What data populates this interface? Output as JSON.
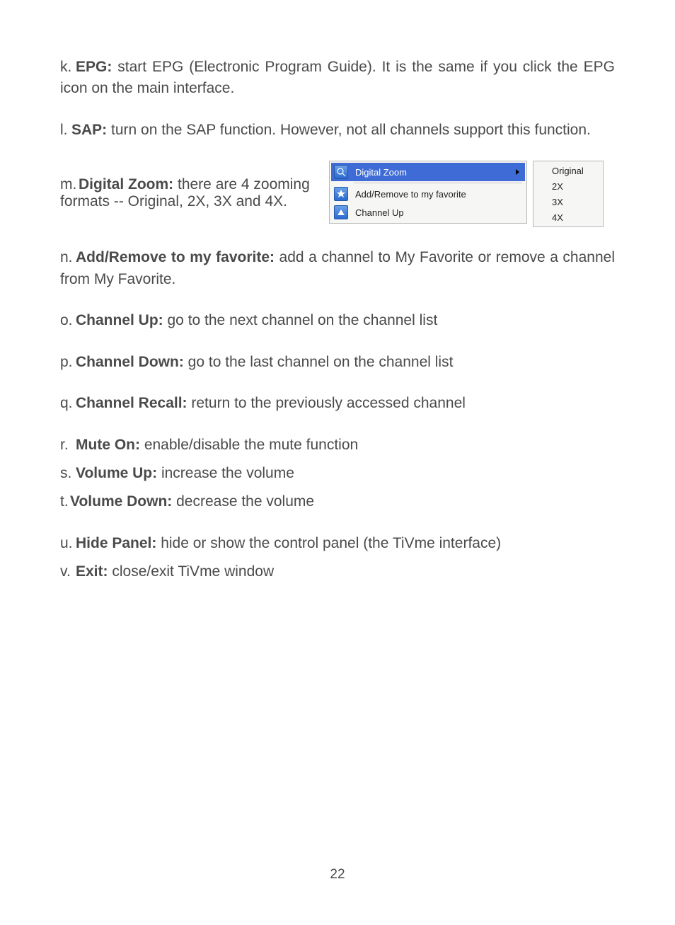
{
  "items": {
    "k": {
      "label": "k.",
      "title": "EPG:",
      "text": " start EPG (Electronic Program Guide). It is the same if you click the EPG icon on the main interface."
    },
    "l": {
      "label": "l.",
      "title": "SAP:",
      "text": " turn on the SAP function. However, not all channels support this function."
    },
    "m": {
      "label": "m.",
      "title": "Digital Zoom:",
      "text": " there are 4 zooming formats -- Original, 2X, 3X and 4X."
    },
    "n": {
      "label": "n.",
      "title": "Add/Remove to my favorite:",
      "text": " add a channel to My Favorite or remove a channel from My Favorite."
    },
    "o": {
      "label": "o.",
      "title": "Channel Up:",
      "text": " go to the next channel on the channel list"
    },
    "p": {
      "label": "p.",
      "title": "Channel Down:",
      "text": " go to the last channel on the channel list"
    },
    "q": {
      "label": "q.",
      "title": "Channel Recall:",
      "text": " return to the previously accessed channel"
    },
    "r": {
      "label": "r.",
      "title": "Mute On:",
      "text": " enable/disable the mute function"
    },
    "s": {
      "label": "s.",
      "title": "Volume Up:",
      "text": " increase the volume"
    },
    "t": {
      "label": "t.",
      "title": "Volume Down:",
      "text": " decrease the volume"
    },
    "u": {
      "label": "u.",
      "title": "Hide Panel:",
      "text": " hide or show the control panel (the TiVme interface)"
    },
    "v": {
      "label": "v.",
      "title": "Exit:",
      "text": " close/exit TiVme window"
    }
  },
  "menu": {
    "digital_zoom": "Digital Zoom",
    "add_remove": "Add/Remove to my favorite",
    "channel_up": "Channel Up",
    "submenu": {
      "original": "Original",
      "x2": "2X",
      "x3": "3X",
      "x4": "4X"
    }
  },
  "page_number": "22"
}
